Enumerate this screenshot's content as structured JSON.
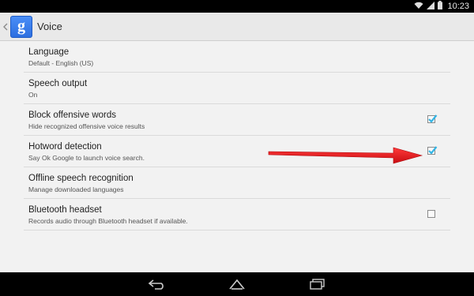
{
  "status_bar": {
    "time": "10:23",
    "icons": [
      "wifi-icon",
      "signal-icon",
      "battery-icon"
    ]
  },
  "action_bar": {
    "app_icon_letter": "g",
    "title": "Voice"
  },
  "preferences": [
    {
      "title": "Language",
      "summary": "Default - English (US)",
      "has_checkbox": false
    },
    {
      "title": "Speech output",
      "summary": "On",
      "has_checkbox": false
    },
    {
      "title": "Block offensive words",
      "summary": "Hide recognized offensive voice results",
      "has_checkbox": true,
      "checked": true
    },
    {
      "title": "Hotword detection",
      "summary": "Say Ok Google to launch voice search.",
      "has_checkbox": true,
      "checked": true
    },
    {
      "title": "Offline speech recognition",
      "summary": "Manage downloaded languages",
      "has_checkbox": false
    },
    {
      "title": "Bluetooth headset",
      "summary": "Records audio through Bluetooth headset if available.",
      "has_checkbox": true,
      "checked": false
    }
  ],
  "nav_bar": {
    "buttons": [
      "back-icon",
      "home-icon",
      "recents-icon"
    ]
  },
  "colors": {
    "accent": "#33b5e5",
    "arrow": "#e8171c",
    "background": "#f2f2f2"
  }
}
